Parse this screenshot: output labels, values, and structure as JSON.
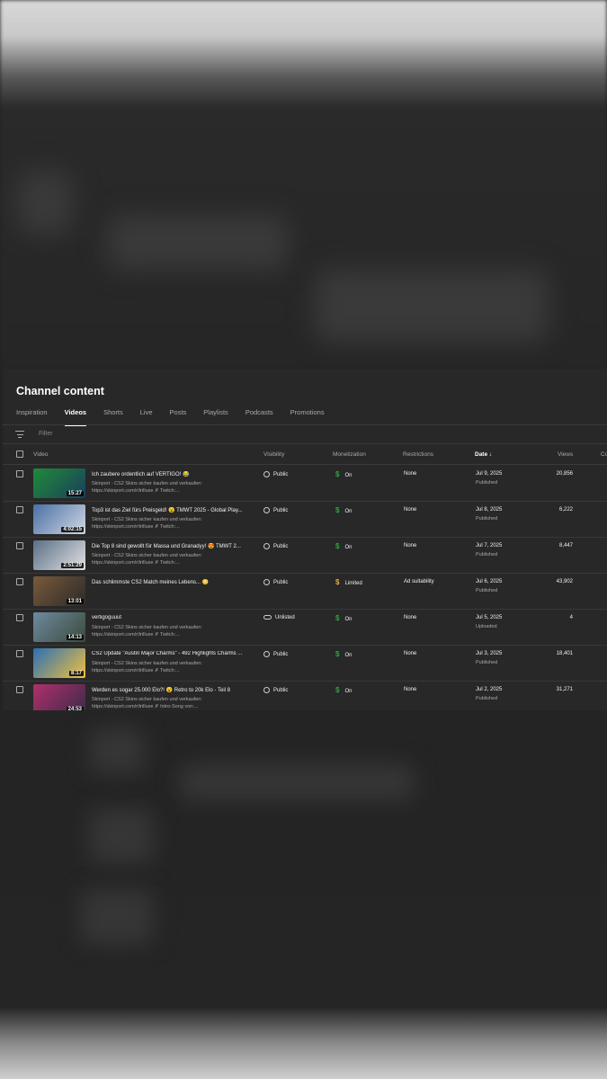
{
  "panel": {
    "title": "Channel content",
    "tabs": [
      {
        "label": "Inspiration",
        "active": false
      },
      {
        "label": "Videos",
        "active": true
      },
      {
        "label": "Shorts",
        "active": false
      },
      {
        "label": "Live",
        "active": false
      },
      {
        "label": "Posts",
        "active": false
      },
      {
        "label": "Playlists",
        "active": false
      },
      {
        "label": "Podcasts",
        "active": false
      },
      {
        "label": "Promotions",
        "active": false
      }
    ],
    "filter_placeholder": "Filter"
  },
  "table": {
    "headers": {
      "video": "Video",
      "visibility": "Visibility",
      "monetization": "Monetization",
      "restrictions": "Restrictions",
      "date": "Date ↓",
      "views": "Views",
      "comments": "Co"
    },
    "rows": [
      {
        "title": "Ich zaubere ordentlich auf VERTIGO! 😂",
        "desc1": "Skinport - CS2 Skins sicher kaufen und verkaufen:",
        "desc2": "https://skinport.com/r/trilluxe ✗ Twitch:...",
        "duration": "15:27",
        "visibility": "Public",
        "monetization": "On",
        "restrictions": "None",
        "date": "Jul 9, 2025",
        "status": "Published",
        "views": "20,856",
        "thumb_a": "#1f8a3a",
        "thumb_b": "#1b3f5c",
        "mon_color": "#2ba640",
        "vis_icon": "globe"
      },
      {
        "title": "Top3 ist das Ziel fürs Preisgeld! 😮 TMWT 2025 - Global Play...",
        "desc1": "Skinport - CS2 Skins sicher kaufen und verkaufen:",
        "desc2": "https://skinport.com/r/trilluxe ✗ Twitch:...",
        "duration": "4:02:15",
        "visibility": "Public",
        "monetization": "On",
        "restrictions": "None",
        "date": "Jul 8, 2025",
        "status": "Published",
        "views": "6,222",
        "thumb_a": "#4a6fa5",
        "thumb_b": "#d0d8e2",
        "mon_color": "#2ba640",
        "vis_icon": "globe"
      },
      {
        "title": "Die Top 8 sind gewollt für Massa und Granadyy! 😍 TMWT 2...",
        "desc1": "Skinport - CS2 Skins sicher kaufen und verkaufen:",
        "desc2": "https://skinport.com/r/trilluxe ✗ Twitch:...",
        "duration": "2:51:29",
        "visibility": "Public",
        "monetization": "On",
        "restrictions": "None",
        "date": "Jul 7, 2025",
        "status": "Published",
        "views": "8,447",
        "thumb_a": "#5a6f86",
        "thumb_b": "#e2e2e2",
        "mon_color": "#2ba640",
        "vis_icon": "globe"
      },
      {
        "title": "Das schlimmste CS2 Match meines Lebens... 😳",
        "desc1": "",
        "desc2": "",
        "duration": "13:01",
        "visibility": "Public",
        "monetization": "Limited",
        "restrictions": "Ad suitability",
        "date": "Jul 6, 2025",
        "status": "Published",
        "views": "43,902",
        "thumb_a": "#7a5a3a",
        "thumb_b": "#2a2a2a",
        "mon_color": "#f2a93b",
        "vis_icon": "globe"
      },
      {
        "title": "vertigoguuut",
        "desc1": "Skinport - CS2 Skins sicher kaufen und verkaufen:",
        "desc2": "https://skinport.com/r/trilluxe ✗ Twitch:...",
        "duration": "14:13",
        "visibility": "Unlisted",
        "monetization": "On",
        "restrictions": "None",
        "date": "Jul 5, 2025",
        "status": "Uploaded",
        "views": "4",
        "thumb_a": "#6f8aa0",
        "thumb_b": "#3a4a3a",
        "mon_color": "#2ba640",
        "vis_icon": "link"
      },
      {
        "title": "CS2 Update \"Austin Major Charms\" - 492 Highlights Charms ...",
        "desc1": "Skinport - CS2 Skins sicher kaufen und verkaufen:",
        "desc2": "https://skinport.com/r/trilluxe ✗ Twitch:...",
        "duration": "8:17",
        "visibility": "Public",
        "monetization": "On",
        "restrictions": "None",
        "date": "Jul 3, 2025",
        "status": "Published",
        "views": "18,401",
        "thumb_a": "#2a6fb5",
        "thumb_b": "#f0c040",
        "mon_color": "#2ba640",
        "vis_icon": "globe"
      },
      {
        "title": "Werden es sogar 25.000 Elo?! 😮 Retro to 20k Elo - Teil 8",
        "desc1": "Skinport - CS2 Skins sicher kaufen und verkaufen:",
        "desc2": "https://skinport.com/r/trilluxe ✗ Intro-Song von:...",
        "duration": "24:53",
        "visibility": "Public",
        "monetization": "On",
        "restrictions": "None",
        "date": "Jul 2, 2025",
        "status": "Published",
        "views": "31,271",
        "thumb_a": "#b0306a",
        "thumb_b": "#3a2a4a",
        "mon_color": "#2ba640",
        "vis_icon": "globe"
      }
    ]
  }
}
